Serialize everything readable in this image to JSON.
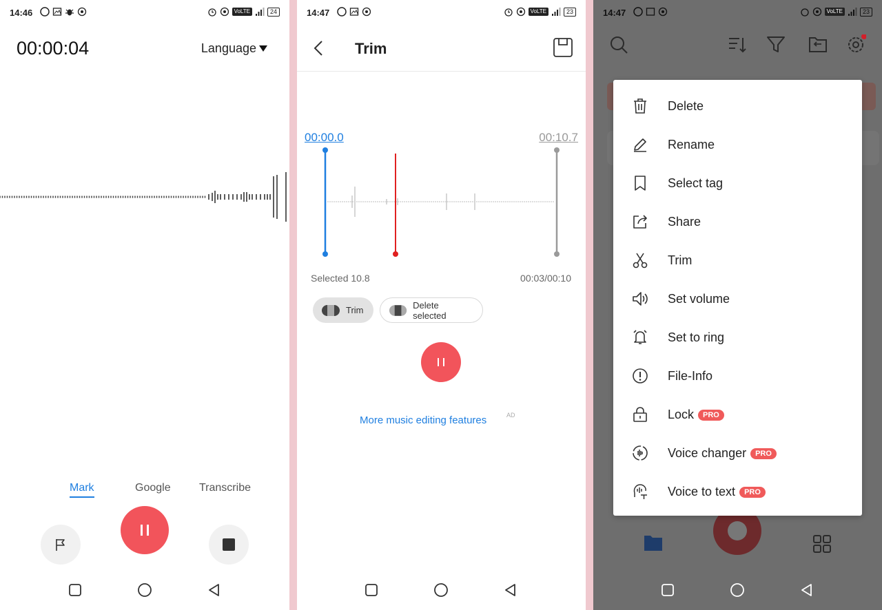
{
  "screen1": {
    "status": {
      "time": "14:46",
      "battery": "24",
      "network": "VoLTE"
    },
    "timer": "00:00:04",
    "language_label": "Language",
    "tabs": [
      {
        "label": "Mark",
        "active": true
      },
      {
        "label": "Google",
        "active": false
      },
      {
        "label": "Transcribe",
        "active": false
      }
    ]
  },
  "screen2": {
    "status": {
      "time": "14:47",
      "battery": "23",
      "network": "VoLTE"
    },
    "title": "Trim",
    "start_time": "00:00.0",
    "end_time": "00:10.7",
    "selected_label": "Selected 10.8",
    "position_label": "00:03/00:10",
    "trim_chip": "Trim",
    "delete_chip": "Delete selected",
    "more_link": "More music editing features",
    "ad_label": "AD"
  },
  "screen3": {
    "status": {
      "time": "14:47",
      "battery": "23",
      "network": "VoLTE"
    },
    "menu": [
      {
        "label": "Delete",
        "icon": "trash-icon",
        "pro": false
      },
      {
        "label": "Rename",
        "icon": "pencil-icon",
        "pro": false
      },
      {
        "label": "Select tag",
        "icon": "bookmark-icon",
        "pro": false
      },
      {
        "label": "Share",
        "icon": "share-icon",
        "pro": false
      },
      {
        "label": "Trim",
        "icon": "scissors-icon",
        "pro": false
      },
      {
        "label": "Set volume",
        "icon": "volume-icon",
        "pro": false
      },
      {
        "label": "Set to ring",
        "icon": "bell-icon",
        "pro": false
      },
      {
        "label": "File-Info",
        "icon": "info-icon",
        "pro": false
      },
      {
        "label": "Lock",
        "icon": "lock-icon",
        "pro": true
      },
      {
        "label": "Voice changer",
        "icon": "voice-changer-icon",
        "pro": true
      },
      {
        "label": "Voice to text",
        "icon": "voice-to-text-icon",
        "pro": true
      }
    ],
    "pro_badge": "PRO"
  },
  "colors": {
    "accent_red": "#f2545b",
    "accent_blue": "#1f7fe0",
    "pro_badge": "#f05a5a"
  }
}
